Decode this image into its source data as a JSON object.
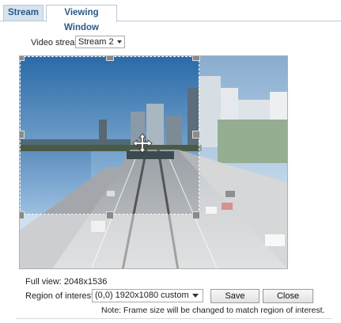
{
  "tabs": [
    {
      "label": "Stream",
      "active": false
    },
    {
      "label": "Viewing Window",
      "active": true
    }
  ],
  "stream": {
    "label": "Video stream :",
    "selected": "Stream 2"
  },
  "info": {
    "full_view": "Full view: 2048x1536",
    "roi_label": "Region of interest :",
    "roi_selected": "(0,0) 1920x1080 custom",
    "note": "Note: Frame size will be changed to match region of interest."
  },
  "buttons": {
    "save": "Save",
    "close": "Close"
  },
  "colors": {
    "tab_text": "#2b5a86",
    "tab_inactive_bg": "#d7e3ef",
    "border": "#b8c8d8",
    "handle": "#8a8a8a"
  },
  "icons": {
    "roi_move": "move-cross-icon",
    "dropdown": "chevron-down-icon"
  }
}
